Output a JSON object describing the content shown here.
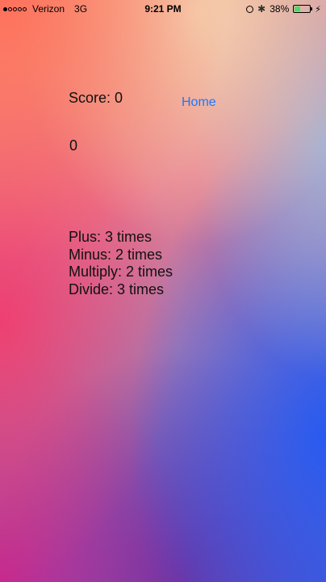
{
  "status_bar": {
    "carrier": "Verizon",
    "network": "3G",
    "time": "9:21 PM",
    "battery": "38%",
    "battery_level": 0.38,
    "signal_bars": 1,
    "signal_total": 5
  },
  "game": {
    "score_text": "Score: 0",
    "display_value": "0",
    "home_label": "Home",
    "stats": [
      "Plus: 3 times",
      "Minus: 2 times",
      "Multiply: 2 times",
      "Divide: 3 times"
    ]
  },
  "colors": {
    "link": "#1a78ff",
    "battery_fill": "#4cd964"
  },
  "icons": [
    "alarm-icon",
    "bluetooth-icon",
    "battery-icon",
    "charging-bolt-icon"
  ]
}
